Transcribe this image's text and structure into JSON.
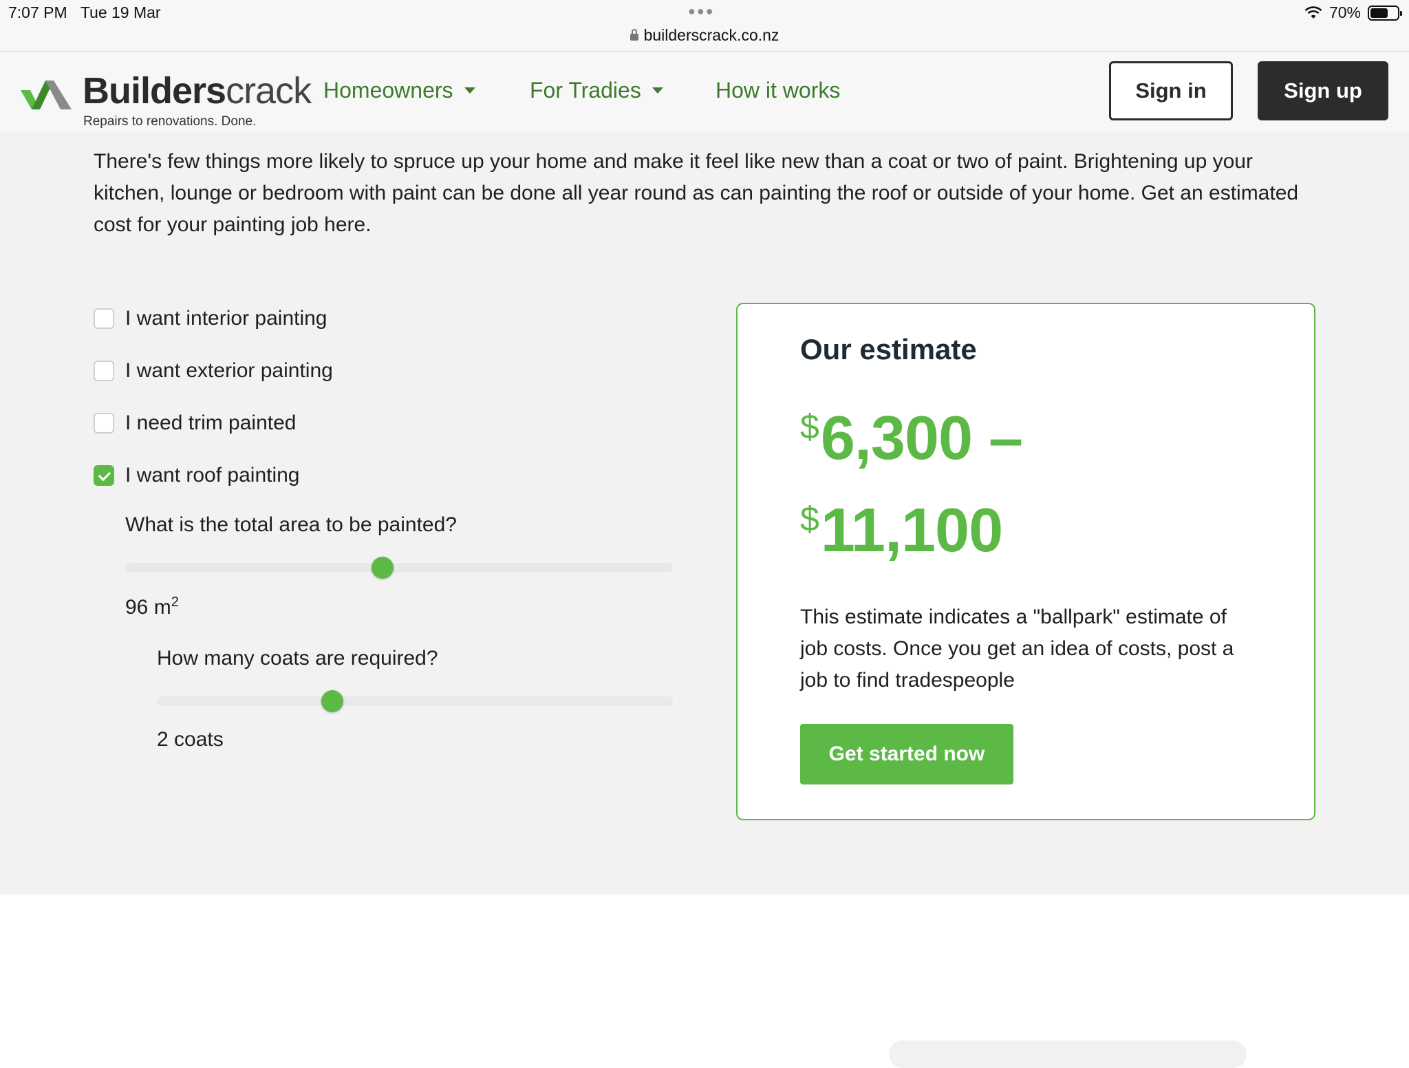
{
  "status_bar": {
    "time": "7:07 PM",
    "date": "Tue 19 Mar",
    "url": "builderscrack.co.nz",
    "battery": "70%",
    "battery_level": 0.7
  },
  "nav": {
    "logo_word_bold": "Builders",
    "logo_word_light": "crack",
    "logo_tagline": "Repairs to renovations. Done.",
    "links": [
      "Homeowners",
      "For Tradies",
      "How it works"
    ],
    "sign_in": "Sign in",
    "sign_up": "Sign up"
  },
  "intro": "There's few things more likely to spruce up your home and make it feel like new than a coat or two of paint. Brightening up your kitchen, lounge or bedroom with paint can be done all year round as can painting the roof or outside of your home. Get an estimated cost for your painting job here.",
  "options": [
    {
      "label": "I want interior painting",
      "checked": false
    },
    {
      "label": "I want exterior painting",
      "checked": false
    },
    {
      "label": "I need trim painted",
      "checked": false
    },
    {
      "label": "I want roof painting",
      "checked": true
    }
  ],
  "area": {
    "question": "What is the total area to be painted?",
    "value_text": "96 m",
    "unit_sup": "2",
    "slider_fraction": 0.47
  },
  "coats": {
    "question": "How many coats are required?",
    "value_text": "2 coats",
    "slider_fraction": 0.34
  },
  "estimate": {
    "title": "Our estimate",
    "currency": "$",
    "low": "6,300 –",
    "high": "11,100",
    "description": "This estimate indicates a \"ballpark\" estimate of job costs. Once you get an idea of costs, post a job to find tradespeople",
    "cta": "Get started now"
  },
  "colors": {
    "brand_green": "#5cb946",
    "link_green": "#3d7a2c",
    "dark": "#2c2c2c",
    "section_bg": "#f2f2f2"
  }
}
